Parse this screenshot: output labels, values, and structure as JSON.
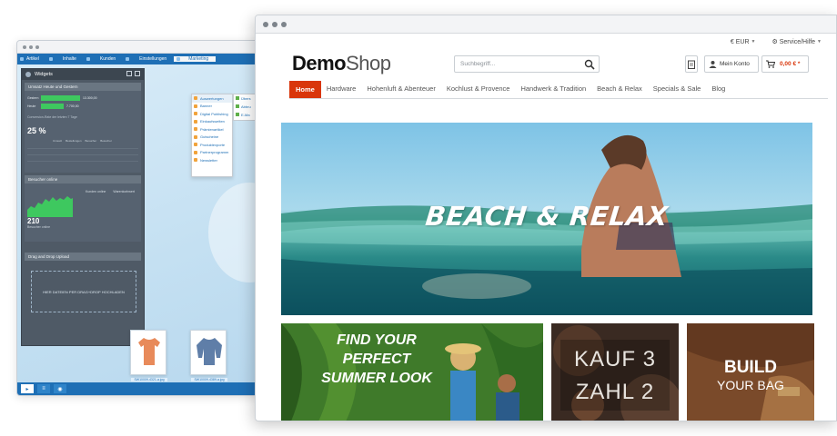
{
  "colors": {
    "accent": "#d9360b",
    "admin_blue": "#1e6fb5",
    "widget_green": "#3ec85f",
    "panel_dark": "#4f5a66"
  },
  "backend": {
    "menu": {
      "items": [
        {
          "label": "Artikel"
        },
        {
          "label": "Inhalte"
        },
        {
          "label": "Kunden"
        },
        {
          "label": "Einstellungen"
        },
        {
          "label": "Marketing"
        }
      ]
    },
    "widgets_title": "Widgets",
    "sales_section": {
      "title": "Umsatz Heute und Gestern",
      "rows": [
        {
          "label": "Gestern",
          "value_label": "13.300,00",
          "fill": 0.62
        },
        {
          "label": "Heute",
          "value_label": "7.700,00",
          "fill": 0.36
        }
      ],
      "conversion_label": "Conversion-Rate der letzten 7 Tage",
      "conversion_value": "25 %",
      "table_headers": [
        "Umsatz",
        "Bestellungen",
        "Besucher",
        "Besucher"
      ]
    },
    "visitors_section": {
      "title": "Besucher online",
      "col_labels": [
        "Kunden online",
        "Warenkorbwert"
      ],
      "count": "210",
      "count_label": "Besucher online"
    },
    "upload_section": {
      "title": "Drag and Drop Upload",
      "drop_text": "HIER DATEIEN PER DRAG+DROP HOCHLADEN"
    },
    "uploads": [
      {
        "caption": "SW10009-4321-a.jpg",
        "color": "#e88a5a"
      },
      {
        "caption": "SW10009-4389-a.jpg",
        "color": "#5f7ea8"
      }
    ],
    "marketing_dropdown": [
      {
        "label": "Auswertungen",
        "highlight": true
      },
      {
        "label": "Banner"
      },
      {
        "label": "Digital Publishing"
      },
      {
        "label": "Einkaufswelten"
      },
      {
        "label": "Prämienartikel"
      },
      {
        "label": "Gutscheine"
      },
      {
        "label": "Produktexporte"
      },
      {
        "label": "Partnerprogramm"
      },
      {
        "label": "Newsletter"
      }
    ],
    "submenu": [
      {
        "label": "Übers"
      },
      {
        "label": "Abbru"
      },
      {
        "label": "E-Ma"
      }
    ]
  },
  "shop": {
    "topbar": {
      "currency": "€ EUR",
      "service": "Service/Hilfe"
    },
    "logo_bold": "Demo",
    "logo_light": "Shop",
    "search_placeholder": "Suchbegriff...",
    "account_label": "Mein Konto",
    "cart_price": "0,00 € *",
    "nav": [
      {
        "label": "Home",
        "active": true
      },
      {
        "label": "Hardware"
      },
      {
        "label": "Hohenluft & Abenteuer"
      },
      {
        "label": "Kochlust & Provence"
      },
      {
        "label": "Handwerk & Tradition"
      },
      {
        "label": "Beach & Relax"
      },
      {
        "label": "Specials & Sale"
      },
      {
        "label": "Blog"
      }
    ],
    "hero_text": "BEACH & RELAX",
    "tiles": [
      {
        "lines": [
          "FIND YOUR",
          "PERFECT",
          "SUMMER LOOK"
        ]
      },
      {
        "lines": [
          "KAUF 3",
          "ZAHL 2"
        ]
      },
      {
        "lines": [
          "BUILD",
          "YOUR BAG"
        ]
      }
    ]
  }
}
